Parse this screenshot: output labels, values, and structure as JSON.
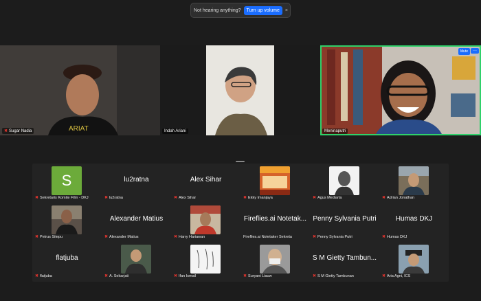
{
  "audio_notice": {
    "text": "Not hearing anything?",
    "button": "Turn up volume",
    "close": "×"
  },
  "videos": [
    {
      "name": "Sugar Nadia",
      "muted": true
    },
    {
      "name": "Indah Ariani",
      "muted": false
    },
    {
      "name": "Meninaputri",
      "muted": false,
      "mute_label": "Mute",
      "more_label": "···"
    }
  ],
  "gallery": {
    "row1": [
      {
        "name": "Sekretaris Komite Film - DKJ",
        "avatar_letter": "S"
      },
      {
        "name": "lu2ratna",
        "display": "lu2ratna"
      },
      {
        "name": "Alex Sihar",
        "display": "Alex Sihar"
      },
      {
        "name": "Ekky Imanjaya"
      },
      {
        "name": "Agus Mediarta"
      },
      {
        "name": "Adrian Jonathan"
      }
    ],
    "row2": [
      {
        "name": "Petrus Sitepu"
      },
      {
        "name": "Alexander Matius",
        "display": "Alexander Matius"
      },
      {
        "name": "Harry Hariawan"
      },
      {
        "name": "Fireflies.ai Notetaker Sekreta",
        "display": "Fireflies.ai Notetak..."
      },
      {
        "name": "Penny Sylvania Putri",
        "display": "Penny Sylvania Putri"
      },
      {
        "name": "Humas DKJ",
        "display": "Humas DKJ"
      }
    ],
    "row3": [
      {
        "name": "flatjuba",
        "display": "flatjuba"
      },
      {
        "name": "A. Sekarjati"
      },
      {
        "name": "Ifan Ismail"
      },
      {
        "name": "Suryani Liauw"
      },
      {
        "name": "S M Gietty Tambunan",
        "display": "S M Gietty Tambun..."
      },
      {
        "name": "Aria Agni, ICS"
      }
    ]
  },
  "colors": {
    "accent": "#1a6dff",
    "active_speaker": "#2fd16a",
    "mic_off": "#e0342e",
    "avatar_green": "#6cab3a"
  },
  "mic_off_icon": "mic-off-icon"
}
